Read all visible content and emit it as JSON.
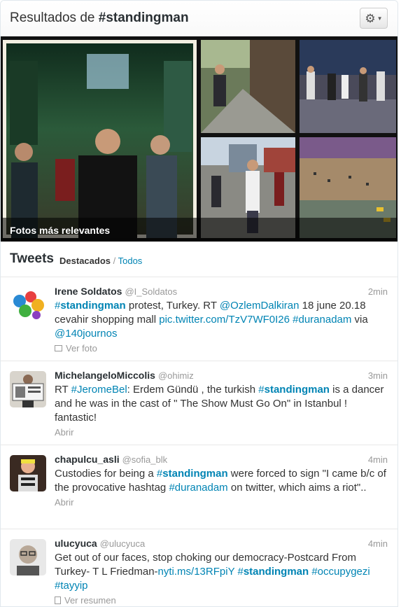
{
  "header": {
    "title_prefix": "Resultados de ",
    "title_query": "#standingman",
    "gear_icon": "gear-icon"
  },
  "photos": {
    "caption": "Fotos más relevantes"
  },
  "tweets_header": {
    "title": "Tweets",
    "filter_active": "Destacados",
    "separator": " / ",
    "filter_all": "Todos"
  },
  "tweets": [
    {
      "fullname": "Irene Soldatos",
      "username": "@I_Soldatos",
      "time": "2min",
      "parts": [
        {
          "t": "#",
          "c": "hash"
        },
        {
          "t": "standingman",
          "c": "hashb"
        },
        {
          "t": " protest, Turkey. RT ",
          "c": ""
        },
        {
          "t": "@OzlemDalkiran",
          "c": "lnk"
        },
        {
          "t": " 18 june 20.18 cevahir shopping mall ",
          "c": ""
        },
        {
          "t": "pic.twitter.com/TzV7WF0I26",
          "c": "lnk"
        },
        {
          "t": " ",
          "c": ""
        },
        {
          "t": "#duranadam",
          "c": "lnk"
        },
        {
          "t": " via ",
          "c": ""
        },
        {
          "t": "@140journos",
          "c": "lnk"
        }
      ],
      "action": "Ver foto",
      "action_icon": "photo-icon"
    },
    {
      "fullname": "MichelangeloMiccolis",
      "username": "@ohimiz",
      "time": "3min",
      "parts": [
        {
          "t": "RT ",
          "c": ""
        },
        {
          "t": "#JeromeBel",
          "c": "lnk"
        },
        {
          "t": ": Erdem Gündü , the turkish ",
          "c": ""
        },
        {
          "t": "#",
          "c": "hash"
        },
        {
          "t": "standingman",
          "c": "hashb"
        },
        {
          "t": " is a dancer and he was in the cast of \" The Show Must Go On\" in Istanbul ! fantastic!",
          "c": ""
        }
      ],
      "action": "Abrir",
      "action_icon": ""
    },
    {
      "fullname": "chapulcu_asli",
      "username": "@sofia_blk",
      "time": "4min",
      "parts": [
        {
          "t": "Custodies for being a ",
          "c": ""
        },
        {
          "t": "#",
          "c": "hash"
        },
        {
          "t": "standingman",
          "c": "hashb"
        },
        {
          "t": " were forced to sign \"I came b/c of the provocative hashtag ",
          "c": ""
        },
        {
          "t": "#duranadam",
          "c": "lnk"
        },
        {
          "t": " on twitter, which aims a riot\"..",
          "c": ""
        }
      ],
      "action": "Abrir",
      "action_icon": ""
    },
    {
      "fullname": "ulucyuca",
      "username": "@ulucyuca",
      "time": "4min",
      "parts": [
        {
          "t": "Get out of our faces, stop choking our democracy-Postcard From Turkey- T L Friedman-",
          "c": ""
        },
        {
          "t": "nyti.ms/13RFpiY",
          "c": "lnk"
        },
        {
          "t": " ",
          "c": ""
        },
        {
          "t": "#",
          "c": "hash"
        },
        {
          "t": "standingman",
          "c": "hashb"
        },
        {
          "t": " ",
          "c": ""
        },
        {
          "t": "#occupygezi",
          "c": "lnk"
        },
        {
          "t": " ",
          "c": ""
        },
        {
          "t": "#tayyip",
          "c": "lnk"
        }
      ],
      "action": "Ver resumen",
      "action_icon": "summary-icon"
    }
  ],
  "colors": {
    "link": "#0084b4",
    "muted": "#999999",
    "caption_bg": "#000000"
  }
}
